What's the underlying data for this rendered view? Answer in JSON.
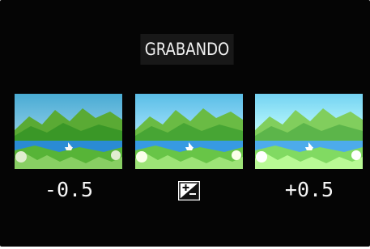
{
  "screen": {
    "status_label": "GRABANDO"
  },
  "bracket": {
    "frames": [
      {
        "ev": "-0.5",
        "brightness": "darker"
      },
      {
        "ev": "",
        "brightness": "normal",
        "indicator": "exposure-compensation-icon"
      },
      {
        "ev": "+0.5",
        "brightness": "brighter"
      }
    ]
  },
  "colors": {
    "background": "#050505",
    "label_background": "#181818",
    "text": "#f2f2f2"
  }
}
